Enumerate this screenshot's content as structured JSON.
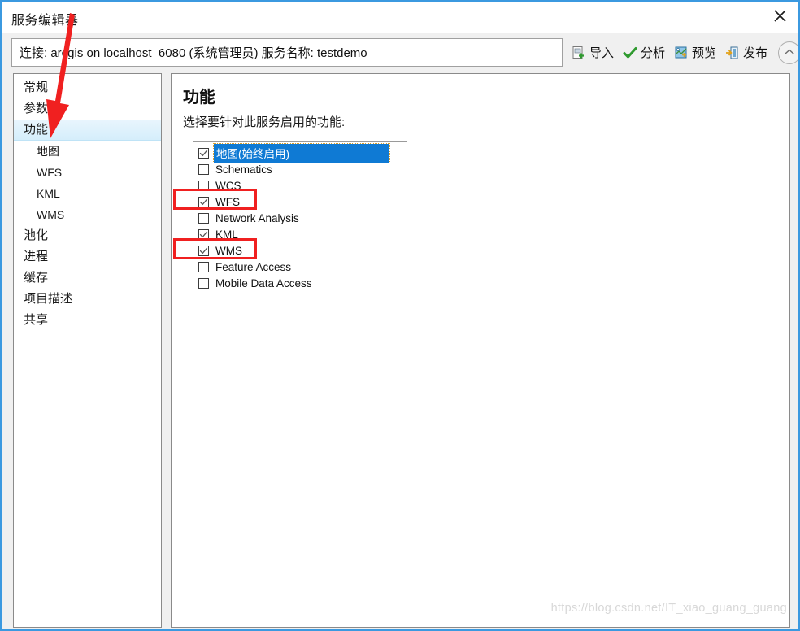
{
  "window": {
    "title": "服务编辑器",
    "close_icon": "close-icon",
    "border_color": "#3b99e0"
  },
  "connection_bar": {
    "text": "连接: arcgis on localhost_6080 (系统管理员)   服务名称: testdemo"
  },
  "toolbar": {
    "buttons": [
      {
        "label": "导入",
        "icon": "import-icon"
      },
      {
        "label": "分析",
        "icon": "checkmark-icon"
      },
      {
        "label": "预览",
        "icon": "preview-icon"
      },
      {
        "label": "发布",
        "icon": "publish-icon"
      }
    ],
    "collapse_icon": "chevron-up-icon"
  },
  "sidebar": {
    "items": [
      {
        "label": "常规",
        "level": 0,
        "selected": false
      },
      {
        "label": "参数",
        "level": 0,
        "selected": false
      },
      {
        "label": "功能",
        "level": 0,
        "selected": true
      },
      {
        "label": "地图",
        "level": 1,
        "selected": false
      },
      {
        "label": "WFS",
        "level": 1,
        "selected": false
      },
      {
        "label": "KML",
        "level": 1,
        "selected": false
      },
      {
        "label": "WMS",
        "level": 1,
        "selected": false
      },
      {
        "label": "池化",
        "level": 0,
        "selected": false
      },
      {
        "label": "进程",
        "level": 0,
        "selected": false
      },
      {
        "label": "缓存",
        "level": 0,
        "selected": false
      },
      {
        "label": "项目描述",
        "level": 0,
        "selected": false
      },
      {
        "label": "共享",
        "level": 0,
        "selected": false
      }
    ]
  },
  "main": {
    "heading": "功能",
    "subtitle": "选择要针对此服务启用的功能:",
    "capabilities": [
      {
        "label": "地图(始终启用)",
        "checked": true,
        "selected": true
      },
      {
        "label": "Schematics",
        "checked": false,
        "selected": false
      },
      {
        "label": "WCS",
        "checked": false,
        "selected": false
      },
      {
        "label": "WFS",
        "checked": true,
        "selected": false
      },
      {
        "label": "Network Analysis",
        "checked": false,
        "selected": false
      },
      {
        "label": "KML",
        "checked": true,
        "selected": false
      },
      {
        "label": "WMS",
        "checked": true,
        "selected": false
      },
      {
        "label": "Feature Access",
        "checked": false,
        "selected": false
      },
      {
        "label": "Mobile Data Access",
        "checked": false,
        "selected": false
      }
    ]
  },
  "annotations": {
    "highlight_color": "#f02020",
    "arrow_color": "#f02020",
    "boxes": [
      {
        "target": "WFS"
      },
      {
        "target": "WMS"
      }
    ],
    "arrow": {
      "points_to": "功能"
    }
  },
  "watermark": {
    "text": "https://blog.csdn.net/IT_xiao_guang_guang"
  }
}
